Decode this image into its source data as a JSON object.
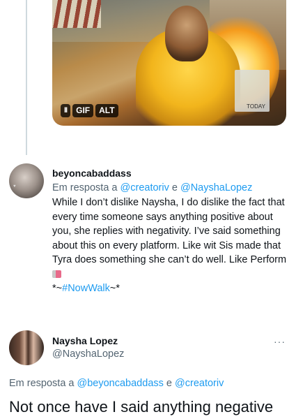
{
  "media": {
    "pause_label": "II",
    "gif_label": "GIF",
    "alt_label": "ALT",
    "sign_text": "TODAY"
  },
  "reply1": {
    "display_name": "beyoncabaddass",
    "reply_prefix": "Em resposta a ",
    "mention_a": "@creatoriv",
    "reply_joiner": " e ",
    "mention_b": "@NayshaLopez",
    "body_text": "While I don’t dislike Naysha, I do dislike the fact that every time someone says anything positive about you, she replies with negativity. I’ve said something about this on every platform. Like wit Sis made that Tyra does something she can’t do well. Like Perform",
    "emoji_icon": "scissors-emoji-icon",
    "hashtag_prefix": "*~",
    "hashtag": "#NowWalk",
    "hashtag_suffix": "~*"
  },
  "tweet2": {
    "display_name": "Naysha Lopez",
    "handle": "@NayshaLopez",
    "more_label": "···",
    "reply_prefix": "Em resposta a ",
    "mention_a": "@beyoncabaddass",
    "reply_joiner": " e ",
    "mention_b": "@creatoriv",
    "body_text": "Not once have I said anything negative"
  },
  "colors": {
    "link": "#1d9bf0",
    "secondary_text": "#536471",
    "primary_text": "#0f1419",
    "thread_line": "#cfd9de"
  }
}
